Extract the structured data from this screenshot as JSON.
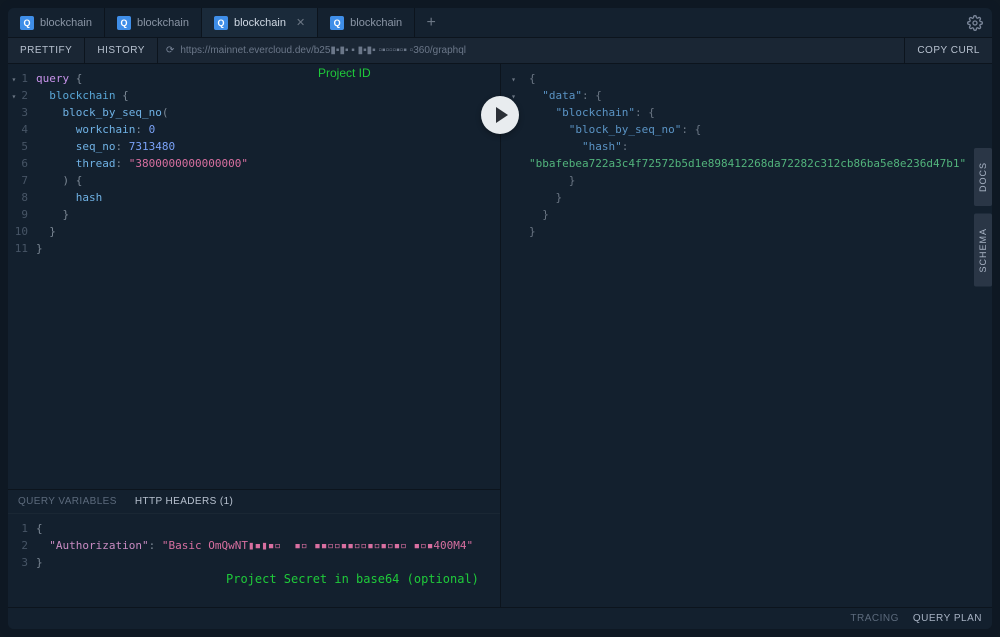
{
  "tabs": [
    {
      "label": "blockchain",
      "active": false,
      "closeable": false
    },
    {
      "label": "blockchain",
      "active": false,
      "closeable": false
    },
    {
      "label": "blockchain",
      "active": true,
      "closeable": true
    },
    {
      "label": "blockchain",
      "active": false,
      "closeable": false
    }
  ],
  "add_tab_label": "+",
  "toolbar": {
    "prettify": "PRETTIFY",
    "history": "HISTORY",
    "url_prefix": "https://mainnet.evercloud.dev/b25▮▪▮▪",
    "url_obscured": " ▪ ▮▪▮▪ ▫▪▫▫▫▪▫▪ ▫",
    "url_suffix": "360/graphql",
    "copy_curl": "COPY CURL"
  },
  "annotations": {
    "project_id": "Project ID",
    "project_secret": "Project Secret in base64 (optional)"
  },
  "query": {
    "lines": [
      {
        "n": "1",
        "fold": "open",
        "html": "<span class='kw'>query</span> <span class='punct'>{</span>"
      },
      {
        "n": "2",
        "fold": "open",
        "html": "  <span class='name'>blockchain</span> <span class='punct'>{</span>"
      },
      {
        "n": "3",
        "fold": "",
        "html": "    <span class='field'>block_by_seq_no</span><span class='punct'>(</span>"
      },
      {
        "n": "4",
        "fold": "",
        "html": "      <span class='field'>workchain</span><span class='punct'>:</span> <span class='num'>0</span>"
      },
      {
        "n": "5",
        "fold": "",
        "html": "      <span class='field'>seq_no</span><span class='punct'>:</span> <span class='num'>7313480</span>"
      },
      {
        "n": "6",
        "fold": "",
        "html": "      <span class='field'>thread</span><span class='punct'>:</span> <span class='str'>\"3800000000000000\"</span>"
      },
      {
        "n": "7",
        "fold": "",
        "html": "    <span class='punct'>) {</span>"
      },
      {
        "n": "8",
        "fold": "",
        "html": "      <span class='field'>hash</span>"
      },
      {
        "n": "9",
        "fold": "",
        "html": "    <span class='punct'>}</span>"
      },
      {
        "n": "10",
        "fold": "",
        "html": "  <span class='punct'>}</span>"
      },
      {
        "n": "11",
        "fold": "",
        "html": "<span class='punct'>}</span>"
      }
    ]
  },
  "result": {
    "lines": [
      {
        "fold": "open",
        "html": "<span class='bracket'>{</span>"
      },
      {
        "fold": "open",
        "html": "  <span class='rkey'>\"data\"</span><span class='bracket'>:</span> <span class='bracket'>{</span>"
      },
      {
        "fold": "open",
        "html": "    <span class='rkey'>\"blockchain\"</span><span class='bracket'>:</span> <span class='bracket'>{</span>"
      },
      {
        "fold": "",
        "html": "      <span class='rkey'>\"block_by_seq_no\"</span><span class='bracket'>:</span> <span class='bracket'>{</span>"
      },
      {
        "fold": "",
        "html": "        <span class='rkey'>\"hash\"</span><span class='bracket'>:</span>"
      },
      {
        "fold": "",
        "html": "<span class='rstr'>\"bbafebea722a3c4f72572b5d1e898412268da72282c312cb86ba5e8e236d47b1\"</span>"
      },
      {
        "fold": "",
        "html": "      <span class='bracket'>}</span>"
      },
      {
        "fold": "",
        "html": "    <span class='bracket'>}</span>"
      },
      {
        "fold": "",
        "html": "  <span class='bracket'>}</span>"
      },
      {
        "fold": "",
        "html": "<span class='bracket'>}</span>"
      }
    ]
  },
  "bottom": {
    "tab_vars": "QUERY VARIABLES",
    "tab_headers": "HTTP HEADERS (1)",
    "lines": [
      {
        "n": "1",
        "html": "<span class='punct'>{</span>"
      },
      {
        "n": "2",
        "html": "  <span class='key'>\"Authorization\"</span><span class='punct'>:</span> <span class='str'>\"Basic OmQwNT▮▪▮▪▫  ▪▫ ▪▪▫▫▪▪▫▫▪▫▪▫▪▫ ▪▫▪400M4\"</span>"
      },
      {
        "n": "3",
        "html": "<span class='punct'>}</span>"
      }
    ]
  },
  "footer": {
    "tracing": "TRACING",
    "query_plan": "QUERY PLAN"
  },
  "rail": {
    "docs": "DOCS",
    "schema": "SCHEMA"
  }
}
